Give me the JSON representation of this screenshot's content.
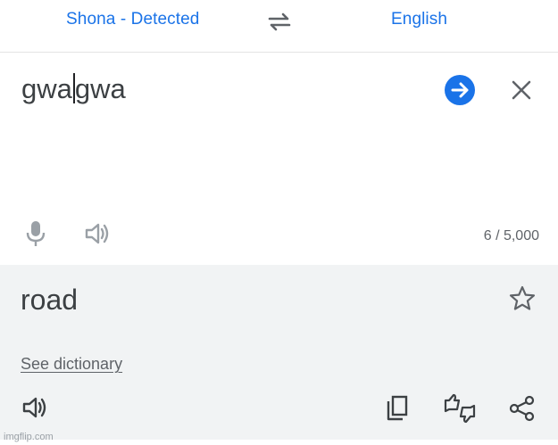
{
  "language_bar": {
    "source_language": "Shona - Detected",
    "target_language": "English",
    "swap_icon": "swap-arrows-icon"
  },
  "input": {
    "text_before_caret": "gwa",
    "text_after_caret": "gwa",
    "char_count": "6 / 5,000",
    "go_icon": "arrow-right-icon",
    "clear_icon": "close-icon",
    "mic_icon": "microphone-icon",
    "speaker_icon": "speaker-icon"
  },
  "output": {
    "translation": "road",
    "see_dictionary": "See dictionary",
    "star_icon": "star-icon",
    "copy_icon": "copy-icon",
    "feedback_icon": "rate-translation-icon",
    "share_icon": "share-icon"
  },
  "watermark": "imgflip.com",
  "colors": {
    "accent": "#1a73e8",
    "text": "#3c4043",
    "muted": "#5f6368",
    "output_background": "#f1f3f4"
  }
}
